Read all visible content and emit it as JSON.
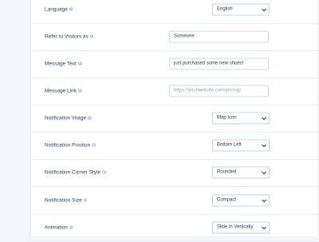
{
  "settings": {
    "language": {
      "label": "Language",
      "value": "English"
    },
    "refer_visitors": {
      "label": "Refer to Visitors as",
      "value": "Someone"
    },
    "message_text": {
      "label": "Message Text",
      "value": "just purchased some new shoes!"
    },
    "message_link": {
      "label": "Message Link",
      "placeholder": "https://yourwebsite.com/pricing/"
    },
    "notification_image": {
      "label": "Notification Image",
      "value": "Map Icon"
    },
    "notification_position": {
      "label": "Notification Position",
      "value": "Bottom Left"
    },
    "notification_corner_style": {
      "label": "Notification Corner Style",
      "value": "Rounded"
    },
    "notification_size": {
      "label": "Notification Size",
      "value": "Compact"
    },
    "animation": {
      "label": "Animation",
      "value": "Slide in Vertically"
    }
  },
  "icons": {
    "info": "info-circle-icon",
    "dropdown": "chevron-down-icon"
  },
  "colors": {
    "background": "#f4f6fb",
    "panel": "#ffffff",
    "label_text": "#2b3a55",
    "border": "#d3d9e6",
    "info_icon": "#a9b6d3"
  }
}
